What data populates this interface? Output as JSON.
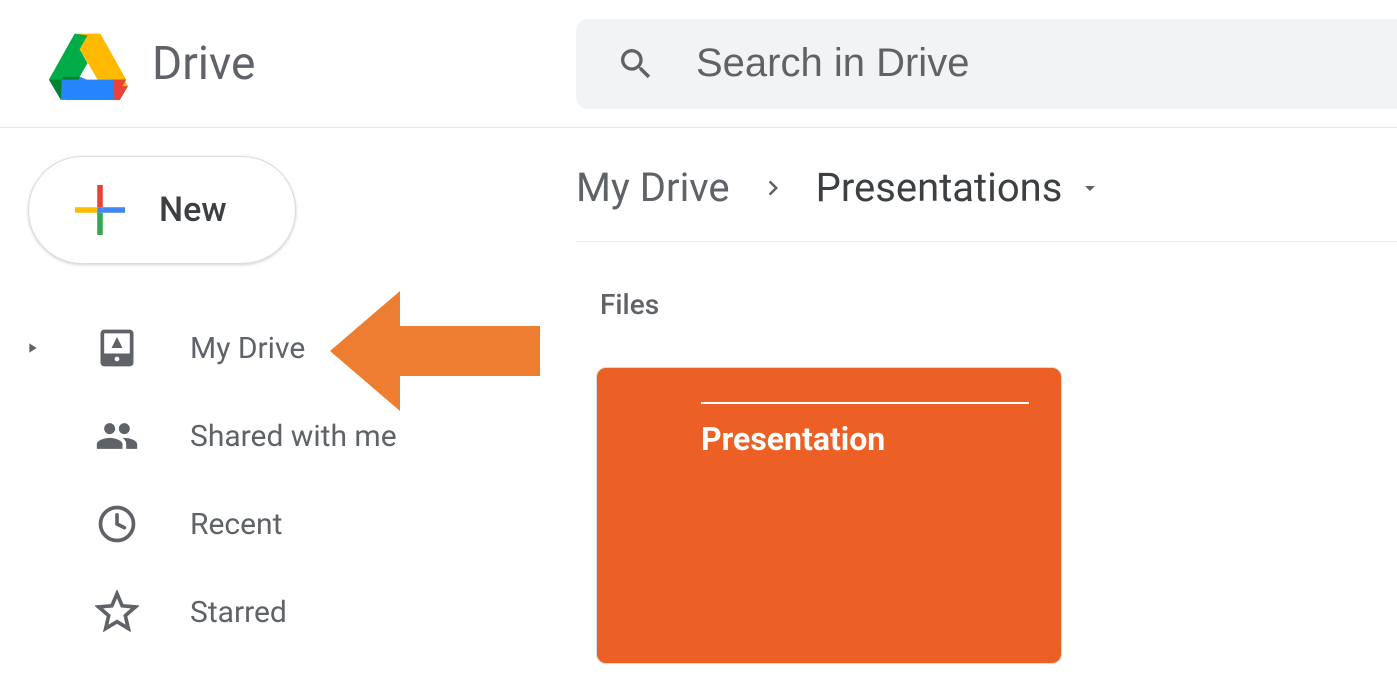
{
  "header": {
    "app_title": "Drive",
    "search_placeholder": "Search in Drive"
  },
  "sidebar": {
    "new_label": "New",
    "items": [
      {
        "label": "My Drive"
      },
      {
        "label": "Shared with me"
      },
      {
        "label": "Recent"
      },
      {
        "label": "Starred"
      }
    ]
  },
  "breadcrumb": {
    "root": "My Drive",
    "current": "Presentations"
  },
  "main": {
    "section_label": "Files",
    "files": [
      {
        "thumb_title": "Presentation",
        "bg_color": "#ec6025"
      }
    ]
  }
}
